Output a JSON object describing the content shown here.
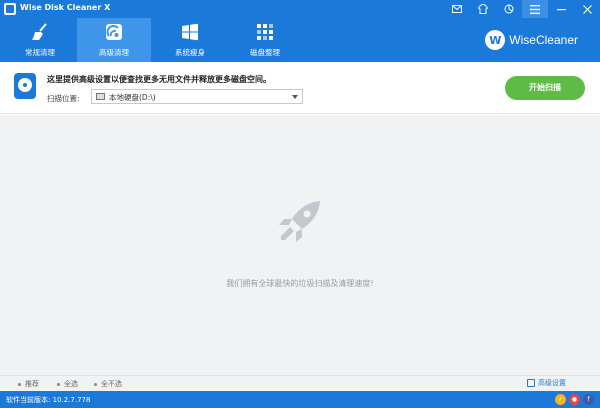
{
  "window": {
    "title": "Wise Disk Cleaner X"
  },
  "nav": {
    "tabs": [
      {
        "label": "常规清理",
        "icon": "broom-icon",
        "active": false
      },
      {
        "label": "高级清理",
        "icon": "advanced-clean-icon",
        "active": true
      },
      {
        "label": "系统瘦身",
        "icon": "windows-icon",
        "active": false
      },
      {
        "label": "磁盘整理",
        "icon": "defrag-icon",
        "active": false
      }
    ],
    "brand": {
      "logo_letter": "W",
      "name": "WiseCleaner"
    }
  },
  "panel": {
    "title": "这里提供高级设置以便查找更多无用文件并释放更多磁盘空间。",
    "location_label": "扫描位置:",
    "location_value": "本地硬盘(D:\\)",
    "scan_button": "开始扫描"
  },
  "main": {
    "empty_message": "我们拥有全球最快的垃圾扫描及清理速度!"
  },
  "options": {
    "recommended": "推荐",
    "select_all": "全选",
    "select_none": "全不选",
    "advanced_settings": "高级设置"
  },
  "status": {
    "version": "软件当前版本: 10.2.7.778"
  },
  "colors": {
    "primary": "#1b7ad9",
    "active_tab": "#3e95ea",
    "scan_button": "#5dbb46",
    "content_bg": "#f1f2f4"
  }
}
